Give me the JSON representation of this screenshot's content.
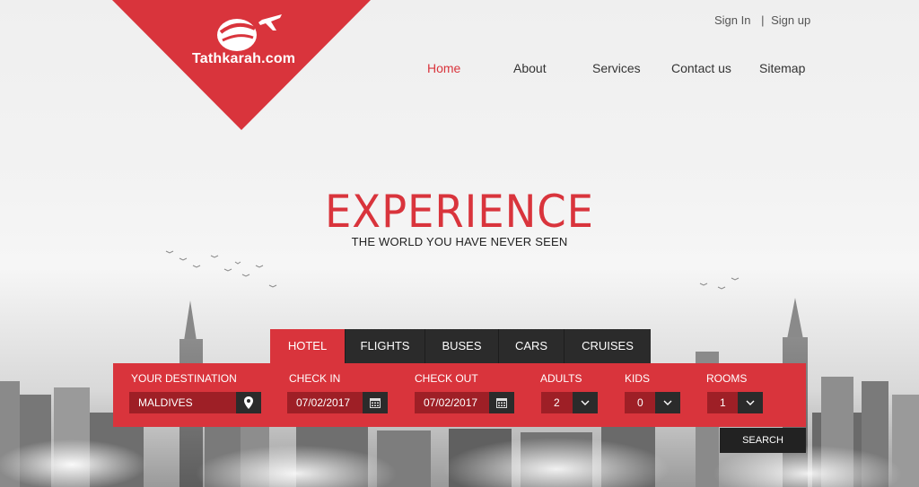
{
  "brand": {
    "name": "Tathkarah.com",
    "color": "#d9343c"
  },
  "auth": {
    "sign_in": "Sign In",
    "separator": "|",
    "sign_up": "Sign up"
  },
  "nav": {
    "items": [
      {
        "label": "Home",
        "active": true
      },
      {
        "label": "About",
        "active": false
      },
      {
        "label": "Services",
        "active": false
      },
      {
        "label": "Contact us",
        "active": false
      },
      {
        "label": "Sitemap",
        "active": false
      }
    ]
  },
  "hero": {
    "title": "EXPERIENCE",
    "subtitle": "THE WORLD YOU HAVE NEVER SEEN"
  },
  "tabs": [
    {
      "label": "HOTEL",
      "active": true
    },
    {
      "label": "FLIGHTS",
      "active": false
    },
    {
      "label": "BUSES",
      "active": false
    },
    {
      "label": "CARS",
      "active": false
    },
    {
      "label": "CRUISES",
      "active": false
    }
  ],
  "search_form": {
    "destination": {
      "label": "YOUR DESTINATION",
      "value": "MALDIVES",
      "icon": "map-pin-icon"
    },
    "check_in": {
      "label": "CHECK IN",
      "value": "07/02/2017",
      "icon": "calendar-icon"
    },
    "check_out": {
      "label": "CHECK OUT",
      "value": "07/02/2017",
      "icon": "calendar-icon"
    },
    "adults": {
      "label": "ADULTS",
      "value": "2",
      "icon": "chevron-down-icon"
    },
    "kids": {
      "label": "KIDS",
      "value": "0",
      "icon": "chevron-down-icon"
    },
    "rooms": {
      "label": "ROOMS",
      "value": "1",
      "icon": "chevron-down-icon"
    },
    "search_label": "SEARCH"
  }
}
